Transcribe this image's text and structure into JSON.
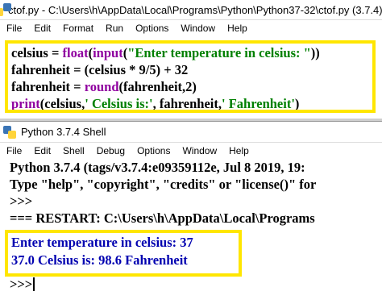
{
  "editor": {
    "title": "ctof.py - C:\\Users\\h\\AppData\\Local\\Programs\\Python\\Python37-32\\ctof.py (3.7.4)",
    "menu": [
      "File",
      "Edit",
      "Format",
      "Run",
      "Options",
      "Window",
      "Help"
    ],
    "code": {
      "l1_a": "celsius = ",
      "l1_b": "float",
      "l1_c": "(",
      "l1_d": "input",
      "l1_e": "(",
      "l1_f": "\"Enter temperature in celsius: \"",
      "l1_g": "))",
      "l2": "fahrenheit = (celsius * 9/5) + 32",
      "l3_a": "fahrenheit = ",
      "l3_b": "round",
      "l3_c": "(fahrenheit,2)",
      "l4_a": "print",
      "l4_b": "(celsius,",
      "l4_c": "' Celsius is:'",
      "l4_d": ", fahrenheit,",
      "l4_e": "' Fahrenheit'",
      "l4_f": ")"
    }
  },
  "shell": {
    "title": "Python 3.7.4 Shell",
    "menu": [
      "File",
      "Edit",
      "Shell",
      "Debug",
      "Options",
      "Window",
      "Help"
    ],
    "lines": [
      "Python 3.7.4 (tags/v3.7.4:e09359112e, Jul  8 2019, 19:",
      "Type \"help\", \"copyright\", \"credits\" or \"license()\" for",
      ">>>",
      "=== RESTART: C:\\Users\\h\\AppData\\Local\\Programs"
    ],
    "output": [
      "Enter temperature in celsius: 37",
      "37.0  Celsius is: 98.6  Fahrenheit"
    ],
    "prompt": ">>>"
  },
  "colors": {
    "highlight_border": "#ffe600",
    "builtin": "#9000a0",
    "string": "#008000",
    "output_text": "#0000b0"
  },
  "icons": [
    "python-icon"
  ]
}
